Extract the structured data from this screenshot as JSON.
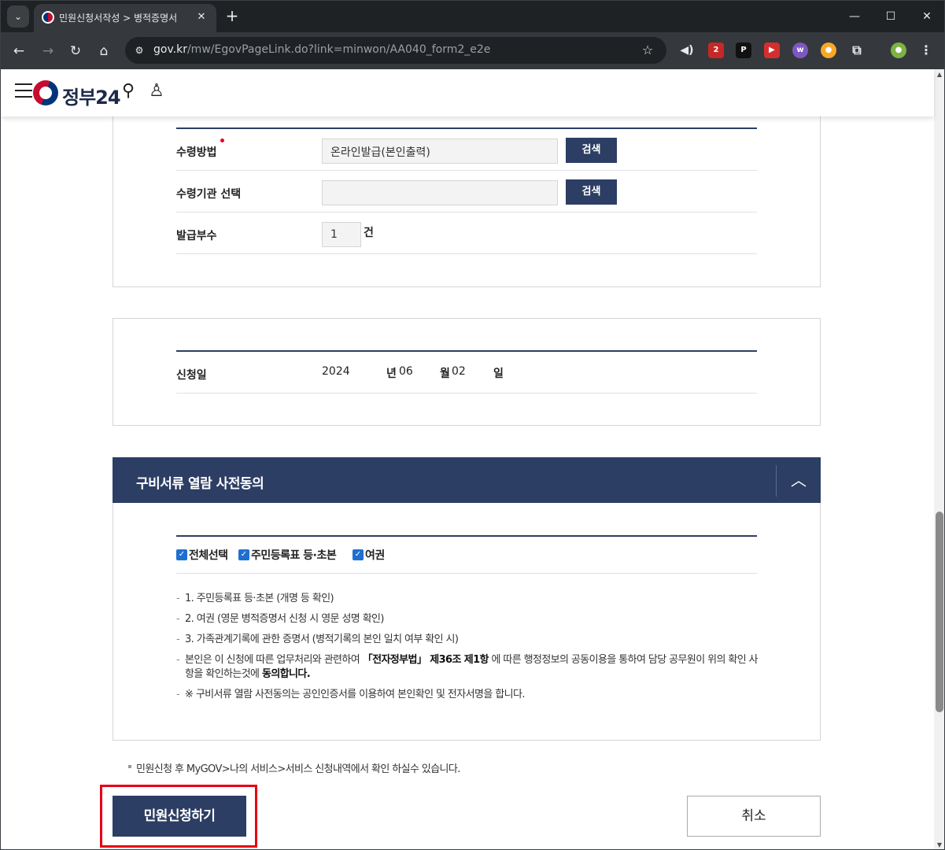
{
  "browser": {
    "tab_title": "민원신청서작성 > 병적증명서",
    "tab_close": "✕",
    "new_tab": "+",
    "url_host": "gov.kr",
    "url_path": "/mw/EgovPageLink.do?link=minwon/AA040_form2_e2e",
    "ext_badge_count": "2"
  },
  "header": {
    "logo_text": "정부24"
  },
  "receipt": {
    "method_label": "수령방법",
    "method_value": "온라인발급(본인출력)",
    "search_label": "검색",
    "agency_label": "수령기관 선택",
    "agency_value": "",
    "copies_label": "발급부수",
    "copies_value": "1",
    "copies_unit": "건"
  },
  "application_date": {
    "label": "신청일",
    "year": "2024",
    "year_unit": "년",
    "month": "06",
    "month_unit": "월",
    "day": "02",
    "day_unit": "일"
  },
  "consent": {
    "title": "구비서류 열람 사전동의",
    "checkboxes": [
      {
        "label": "전체선택",
        "checked": true
      },
      {
        "label": "주민등록표 등·초본",
        "checked": true
      },
      {
        "label": "여권",
        "checked": true
      }
    ],
    "notes": [
      "1. 주민등록표 등·초본 (개명 등 확인)",
      "2. 여권 (영문 병적증명서 신청 시 영문 성명 확인)",
      "3. 가족관계기록에 관한 증명서 (병적기록의 본인 일치 여부 확인 시)"
    ],
    "agree_pre": "본인은 이 신청에 따른 업무처리와 관련하여 ",
    "agree_law": "「전자정부법」 제36조 제1항",
    "agree_mid": " 에 따른 행정정보의 공동이용을 통하여 담당 공무원이 위의 확인 사항을 확인하는것에 ",
    "agree_end": "동의합니다.",
    "cert_note": "※ 구비서류 열람 사전동의는 공인인증서를 이용하여 본인확인 및 전자서명을 합니다."
  },
  "footnote": "민원신청 후 MyGOV>나의 서비스>서비스 신청내역에서 확인 하실수 있습니다.",
  "actions": {
    "apply": "민원신청하기",
    "cancel": "취소"
  },
  "colors": {
    "navy": "#2d3e64",
    "highlight": "#e60012",
    "checkbox": "#1f6fd1"
  }
}
